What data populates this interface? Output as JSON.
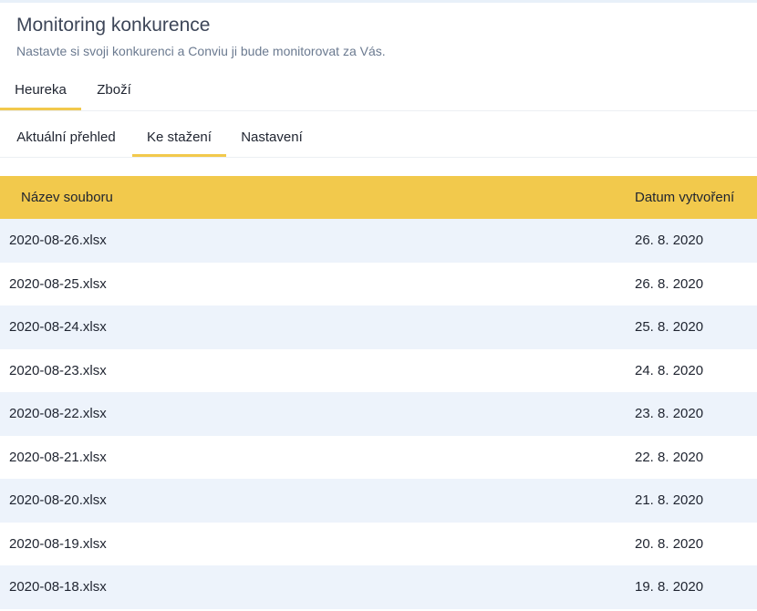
{
  "header": {
    "title": "Monitoring konkurence",
    "subtitle": "Nastavte si svoji konkurenci a Conviu ji bude monitorovat za Vás."
  },
  "tabs_primary": [
    {
      "label": "Heureka",
      "active": true
    },
    {
      "label": "Zboží",
      "active": false
    }
  ],
  "tabs_secondary": [
    {
      "label": "Aktuální přehled",
      "active": false
    },
    {
      "label": "Ke stažení",
      "active": true
    },
    {
      "label": "Nastavení",
      "active": false
    }
  ],
  "table": {
    "columns": [
      "Název souboru",
      "Datum vytvoření"
    ],
    "rows": [
      {
        "file": "2020-08-26.xlsx",
        "date": "26. 8. 2020"
      },
      {
        "file": "2020-08-25.xlsx",
        "date": "26. 8. 2020"
      },
      {
        "file": "2020-08-24.xlsx",
        "date": "25. 8. 2020"
      },
      {
        "file": "2020-08-23.xlsx",
        "date": "24. 8. 2020"
      },
      {
        "file": "2020-08-22.xlsx",
        "date": "23. 8. 2020"
      },
      {
        "file": "2020-08-21.xlsx",
        "date": "22. 8. 2020"
      },
      {
        "file": "2020-08-20.xlsx",
        "date": "21. 8. 2020"
      },
      {
        "file": "2020-08-19.xlsx",
        "date": "20. 8. 2020"
      },
      {
        "file": "2020-08-18.xlsx",
        "date": "19. 8. 2020"
      }
    ]
  },
  "colors": {
    "accent": "#f2c94c",
    "row_stripe": "#edf3fb"
  }
}
